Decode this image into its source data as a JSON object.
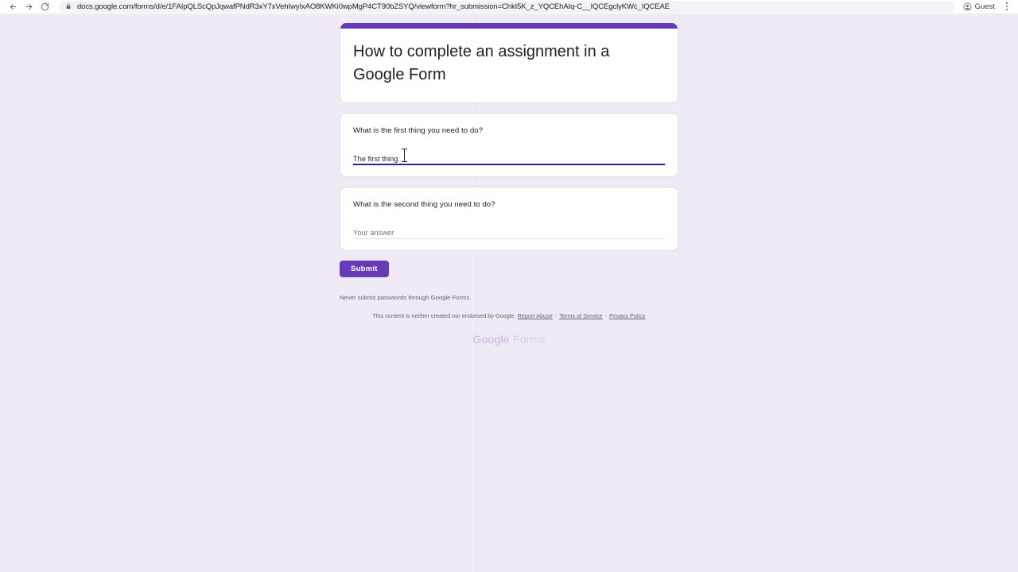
{
  "browser": {
    "back_icon": "back-arrow-icon",
    "forward_icon": "forward-arrow-icon",
    "reload_icon": "reload-icon",
    "lock_icon": "lock-icon",
    "url": "docs.google.com/forms/d/e/1FAIpQLScQpJqwafPNdR3xY7xVehIwyIxAO8KWKi0wpMgP4CT90bZSYQ/viewform?hr_submission=ChkI5K_z_YQCEhAIq-C__IQCEgclyKWc_IQCEAE",
    "profile_label": "Guest",
    "profile_icon": "account-avatar-icon",
    "menu_icon": "three-dot-menu-icon"
  },
  "form": {
    "title": "How to complete an assignment in a Google Form",
    "accent_color": "#673ab7",
    "page_background": "#efeaf6",
    "questions": [
      {
        "title": "What is the first thing you need to do?",
        "answer_value": "The first thing",
        "placeholder": "Your answer",
        "focused": true
      },
      {
        "title": "What is the second thing you need to do?",
        "answer_value": "",
        "placeholder": "Your answer",
        "focused": false
      }
    ],
    "submit_label": "Submit",
    "passwords_note": "Never submit passwords through Google Forms.",
    "disclaimer": {
      "text": "This content is neither created nor endorsed by Google.",
      "report_abuse": "Report Abuse",
      "terms": "Terms of Service",
      "privacy": "Privacy Policy",
      "separator": "-"
    },
    "footer_logo": {
      "google": "Google",
      "forms": "Forms"
    }
  }
}
